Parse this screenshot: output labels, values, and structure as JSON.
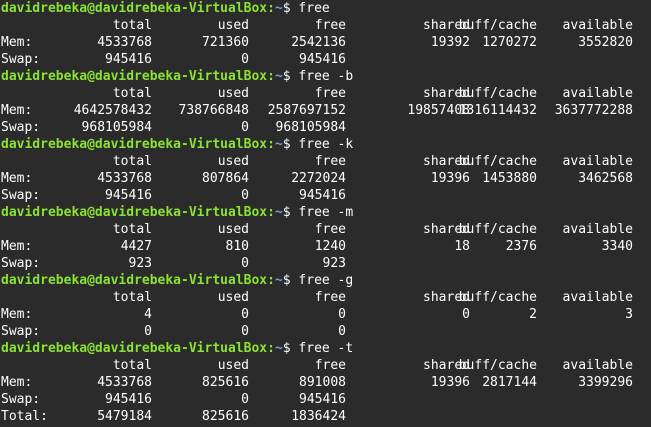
{
  "colors": {
    "background": "#2b2b2b",
    "text": "#ffffff",
    "prompt_user": "#8ae234",
    "prompt_path": "#729fcf"
  },
  "prompt": {
    "user_host": "davidrebeka@davidrebeka-VirtualBox",
    "separator": ":",
    "path": "~",
    "dollar": "$"
  },
  "header": [
    "total",
    "used",
    "free",
    "shared",
    "buff/cache",
    "available"
  ],
  "blocks": [
    {
      "command": "free",
      "rows": [
        {
          "label": "Mem:",
          "values": [
            "4533768",
            "721360",
            "2542136",
            "19392",
            "1270272",
            "3552820"
          ]
        },
        {
          "label": "Swap:",
          "values": [
            "945416",
            "0",
            "945416",
            "",
            "",
            ""
          ]
        }
      ]
    },
    {
      "command": "free -b",
      "rows": [
        {
          "label": "Mem:",
          "values": [
            "4642578432",
            "738766848",
            "2587697152",
            "19857408",
            "1316114432",
            "3637772288"
          ]
        },
        {
          "label": "Swap:",
          "values": [
            "968105984",
            "0",
            "968105984",
            "",
            "",
            ""
          ]
        }
      ]
    },
    {
      "command": "free -k",
      "rows": [
        {
          "label": "Mem:",
          "values": [
            "4533768",
            "807864",
            "2272024",
            "19396",
            "1453880",
            "3462568"
          ]
        },
        {
          "label": "Swap:",
          "values": [
            "945416",
            "0",
            "945416",
            "",
            "",
            ""
          ]
        }
      ]
    },
    {
      "command": "free -m",
      "rows": [
        {
          "label": "Mem:",
          "values": [
            "4427",
            "810",
            "1240",
            "18",
            "2376",
            "3340"
          ]
        },
        {
          "label": "Swap:",
          "values": [
            "923",
            "0",
            "923",
            "",
            "",
            ""
          ]
        }
      ]
    },
    {
      "command": "free -g",
      "rows": [
        {
          "label": "Mem:",
          "values": [
            "4",
            "0",
            "0",
            "0",
            "2",
            "3"
          ]
        },
        {
          "label": "Swap:",
          "values": [
            "0",
            "0",
            "0",
            "",
            "",
            ""
          ]
        }
      ]
    },
    {
      "command": "free -t",
      "rows": [
        {
          "label": "Mem:",
          "values": [
            "4533768",
            "825616",
            "891008",
            "19396",
            "2817144",
            "3399296"
          ]
        },
        {
          "label": "Swap:",
          "values": [
            "945416",
            "0",
            "945416",
            "",
            "",
            ""
          ]
        },
        {
          "label": "Total:",
          "values": [
            "5479184",
            "825616",
            "1836424",
            "",
            "",
            ""
          ]
        }
      ]
    }
  ]
}
